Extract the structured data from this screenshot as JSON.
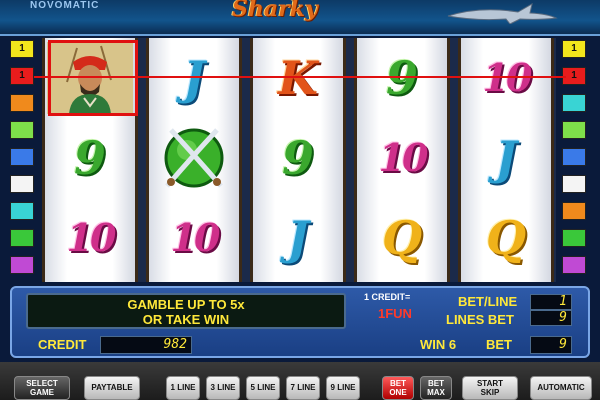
{
  "header": {
    "brand": "NOVOMATIC",
    "logo": "Sharky",
    "logo_icon": "shark-icon"
  },
  "paylines_left": [
    {
      "label": "1",
      "color": "#f2e61c"
    },
    {
      "label": "1",
      "color": "#e81c1c"
    },
    {
      "label": "",
      "color": "#f08a1c"
    },
    {
      "label": "",
      "color": "#7ee04a"
    },
    {
      "label": "",
      "color": "#3a7ae8"
    },
    {
      "label": "",
      "color": "#f4f4f4"
    },
    {
      "label": "",
      "color": "#39d4d4"
    },
    {
      "label": "",
      "color": "#3ac83a"
    },
    {
      "label": "",
      "color": "#c04ad4"
    }
  ],
  "paylines_right": [
    {
      "label": "1",
      "color": "#f2e61c"
    },
    {
      "label": "1",
      "color": "#e81c1c"
    },
    {
      "label": "",
      "color": "#39d4d4"
    },
    {
      "label": "",
      "color": "#7ee04a"
    },
    {
      "label": "",
      "color": "#3a7ae8"
    },
    {
      "label": "",
      "color": "#f4f4f4"
    },
    {
      "label": "",
      "color": "#f08a1c"
    },
    {
      "label": "",
      "color": "#3ac83a"
    },
    {
      "label": "",
      "color": "#c04ad4"
    }
  ],
  "reels": [
    [
      {
        "symbol": "pirate"
      },
      {
        "symbol": "9",
        "cls": "c-9"
      },
      {
        "symbol": "10",
        "cls": "c-10"
      }
    ],
    [
      {
        "symbol": "J",
        "cls": "c-j"
      },
      {
        "symbol": "swords"
      },
      {
        "symbol": "10",
        "cls": "c-10"
      }
    ],
    [
      {
        "symbol": "K",
        "cls": "c-k"
      },
      {
        "symbol": "9",
        "cls": "c-9"
      },
      {
        "symbol": "J",
        "cls": "c-j"
      }
    ],
    [
      {
        "symbol": "9",
        "cls": "c-9"
      },
      {
        "symbol": "10",
        "cls": "c-10"
      },
      {
        "symbol": "Q",
        "cls": "c-q"
      }
    ],
    [
      {
        "symbol": "10",
        "cls": "c-10"
      },
      {
        "symbol": "J",
        "cls": "c-j"
      },
      {
        "symbol": "Q",
        "cls": "c-q"
      }
    ]
  ],
  "panel": {
    "message_line1": "GAMBLE UP TO 5x",
    "message_line2": "OR TAKE WIN",
    "credit_rate": "1 CREDIT=",
    "fun": "1FUN",
    "bet_line_label": "BET/LINE",
    "lines_bet_label": "LINES BET",
    "bet_per_line": "1",
    "lines": "9",
    "credit_label": "CREDIT",
    "credit": "982",
    "win_label": "WIN 6",
    "bet_label": "BET",
    "bet": "9"
  },
  "buttons": {
    "select_game_1": "SELECT",
    "select_game_2": "GAME",
    "paytable": "PAYTABLE",
    "line1": "1 LINE",
    "line3": "3 LINE",
    "line5": "5 LINE",
    "line7": "7 LINE",
    "line9": "9 LINE",
    "bet_one_1": "BET",
    "bet_one_2": "ONE",
    "bet_max_1": "BET",
    "bet_max_2": "MAX",
    "start_1": "START",
    "start_2": "SKIP",
    "automatic": "AUTOMATIC"
  }
}
